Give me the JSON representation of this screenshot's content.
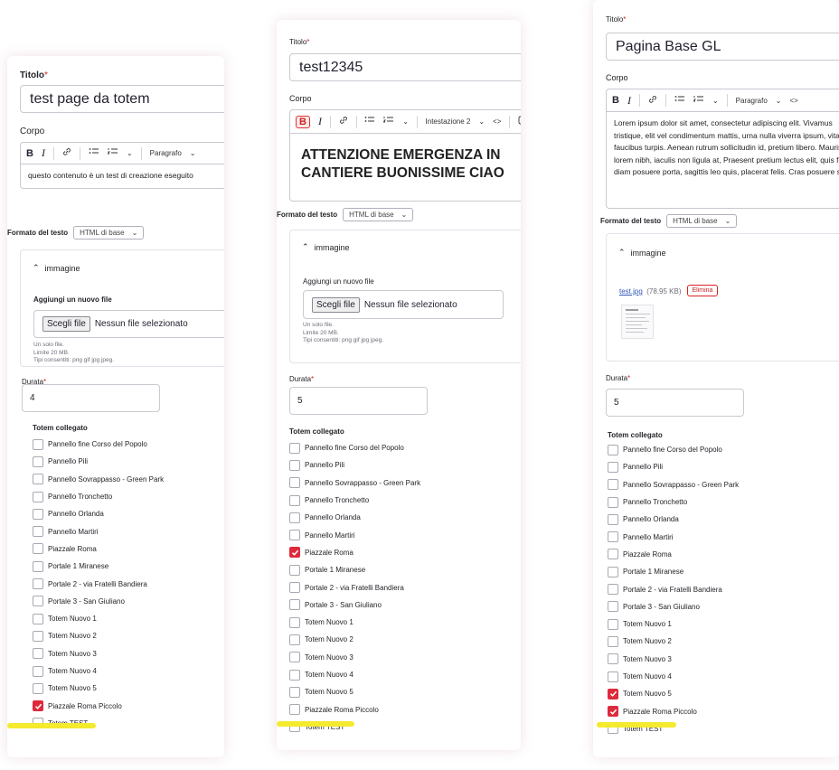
{
  "labels": {
    "title": "Titolo",
    "required": "*",
    "body": "Corpo",
    "format": "Formato del testo",
    "add_file": "Aggiungi un nuovo file",
    "choose_file": "Scegli file",
    "no_file": "Nessun file selezionato",
    "help_1": "Un solo file.",
    "help_2": "Limite 20 MB.",
    "help_3": "Tipi consentiti: png gif jpg jpeg.",
    "duration": "Durata",
    "linked_totem": "Totem collegato",
    "image_section": "immagine",
    "delete": "Elimina"
  },
  "toolbar": {
    "bold": "B",
    "italic": "I",
    "paragraph": "Paragrafo",
    "heading2": "Intestazione 2",
    "code": "<>"
  },
  "format_value": "HTML di base",
  "totem_options": [
    "Pannello fine Corso del Popolo",
    "Pannello Pili",
    "Pannello Sovrappasso - Green Park",
    "Pannello Tronchetto",
    "Pannello Orlanda",
    "Pannello Martiri",
    "Piazzale Roma",
    "Portale 1 Miranese",
    "Portale 2 - via Fratelli Bandiera",
    "Portale 3 - San Giuliano",
    "Totem Nuovo 1",
    "Totem Nuovo 2",
    "Totem Nuovo 3",
    "Totem Nuovo 4",
    "Totem Nuovo 5",
    "Piazzale Roma Piccolo",
    "Totem TEST"
  ],
  "forms": [
    {
      "title_value": "test page da totem",
      "body_text": "questo contenuto è un test di creazione eseguito",
      "duration_value": "4",
      "checked": [
        15
      ],
      "highlight_colour": "#f4ea2e"
    },
    {
      "title_value": "test12345",
      "body_heading": "ATTENZIONE EMERGENZA IN CANTIERE BUONISSIME CIAO",
      "duration_value": "5",
      "checked": [
        6
      ]
    },
    {
      "title_value": "Pagina Base GL",
      "body_text": "Lorem ipsum dolor sit amet, consectetur adipiscing elit. Vivamus tristique, elit vel condimentum mattis, urna nulla viverra ipsum, vitae faucibus turpis. Aenean rutrum sollicitudin id, pretium libero. Mauris lorem nibh, iaculis non ligula at, Praesent pretium lectus elit, quis feugiat diam posuere porta, sagittis leo quis, placerat felis. Cras posuere sed",
      "file_name": "test.jpg",
      "file_size": "(78.95 KB)",
      "duration_value": "5",
      "checked": [
        14,
        15
      ]
    }
  ],
  "colors": {
    "accent_red": "#dd2a3c",
    "link_blue": "#3057b8",
    "highlight": "#f4ea2e"
  }
}
